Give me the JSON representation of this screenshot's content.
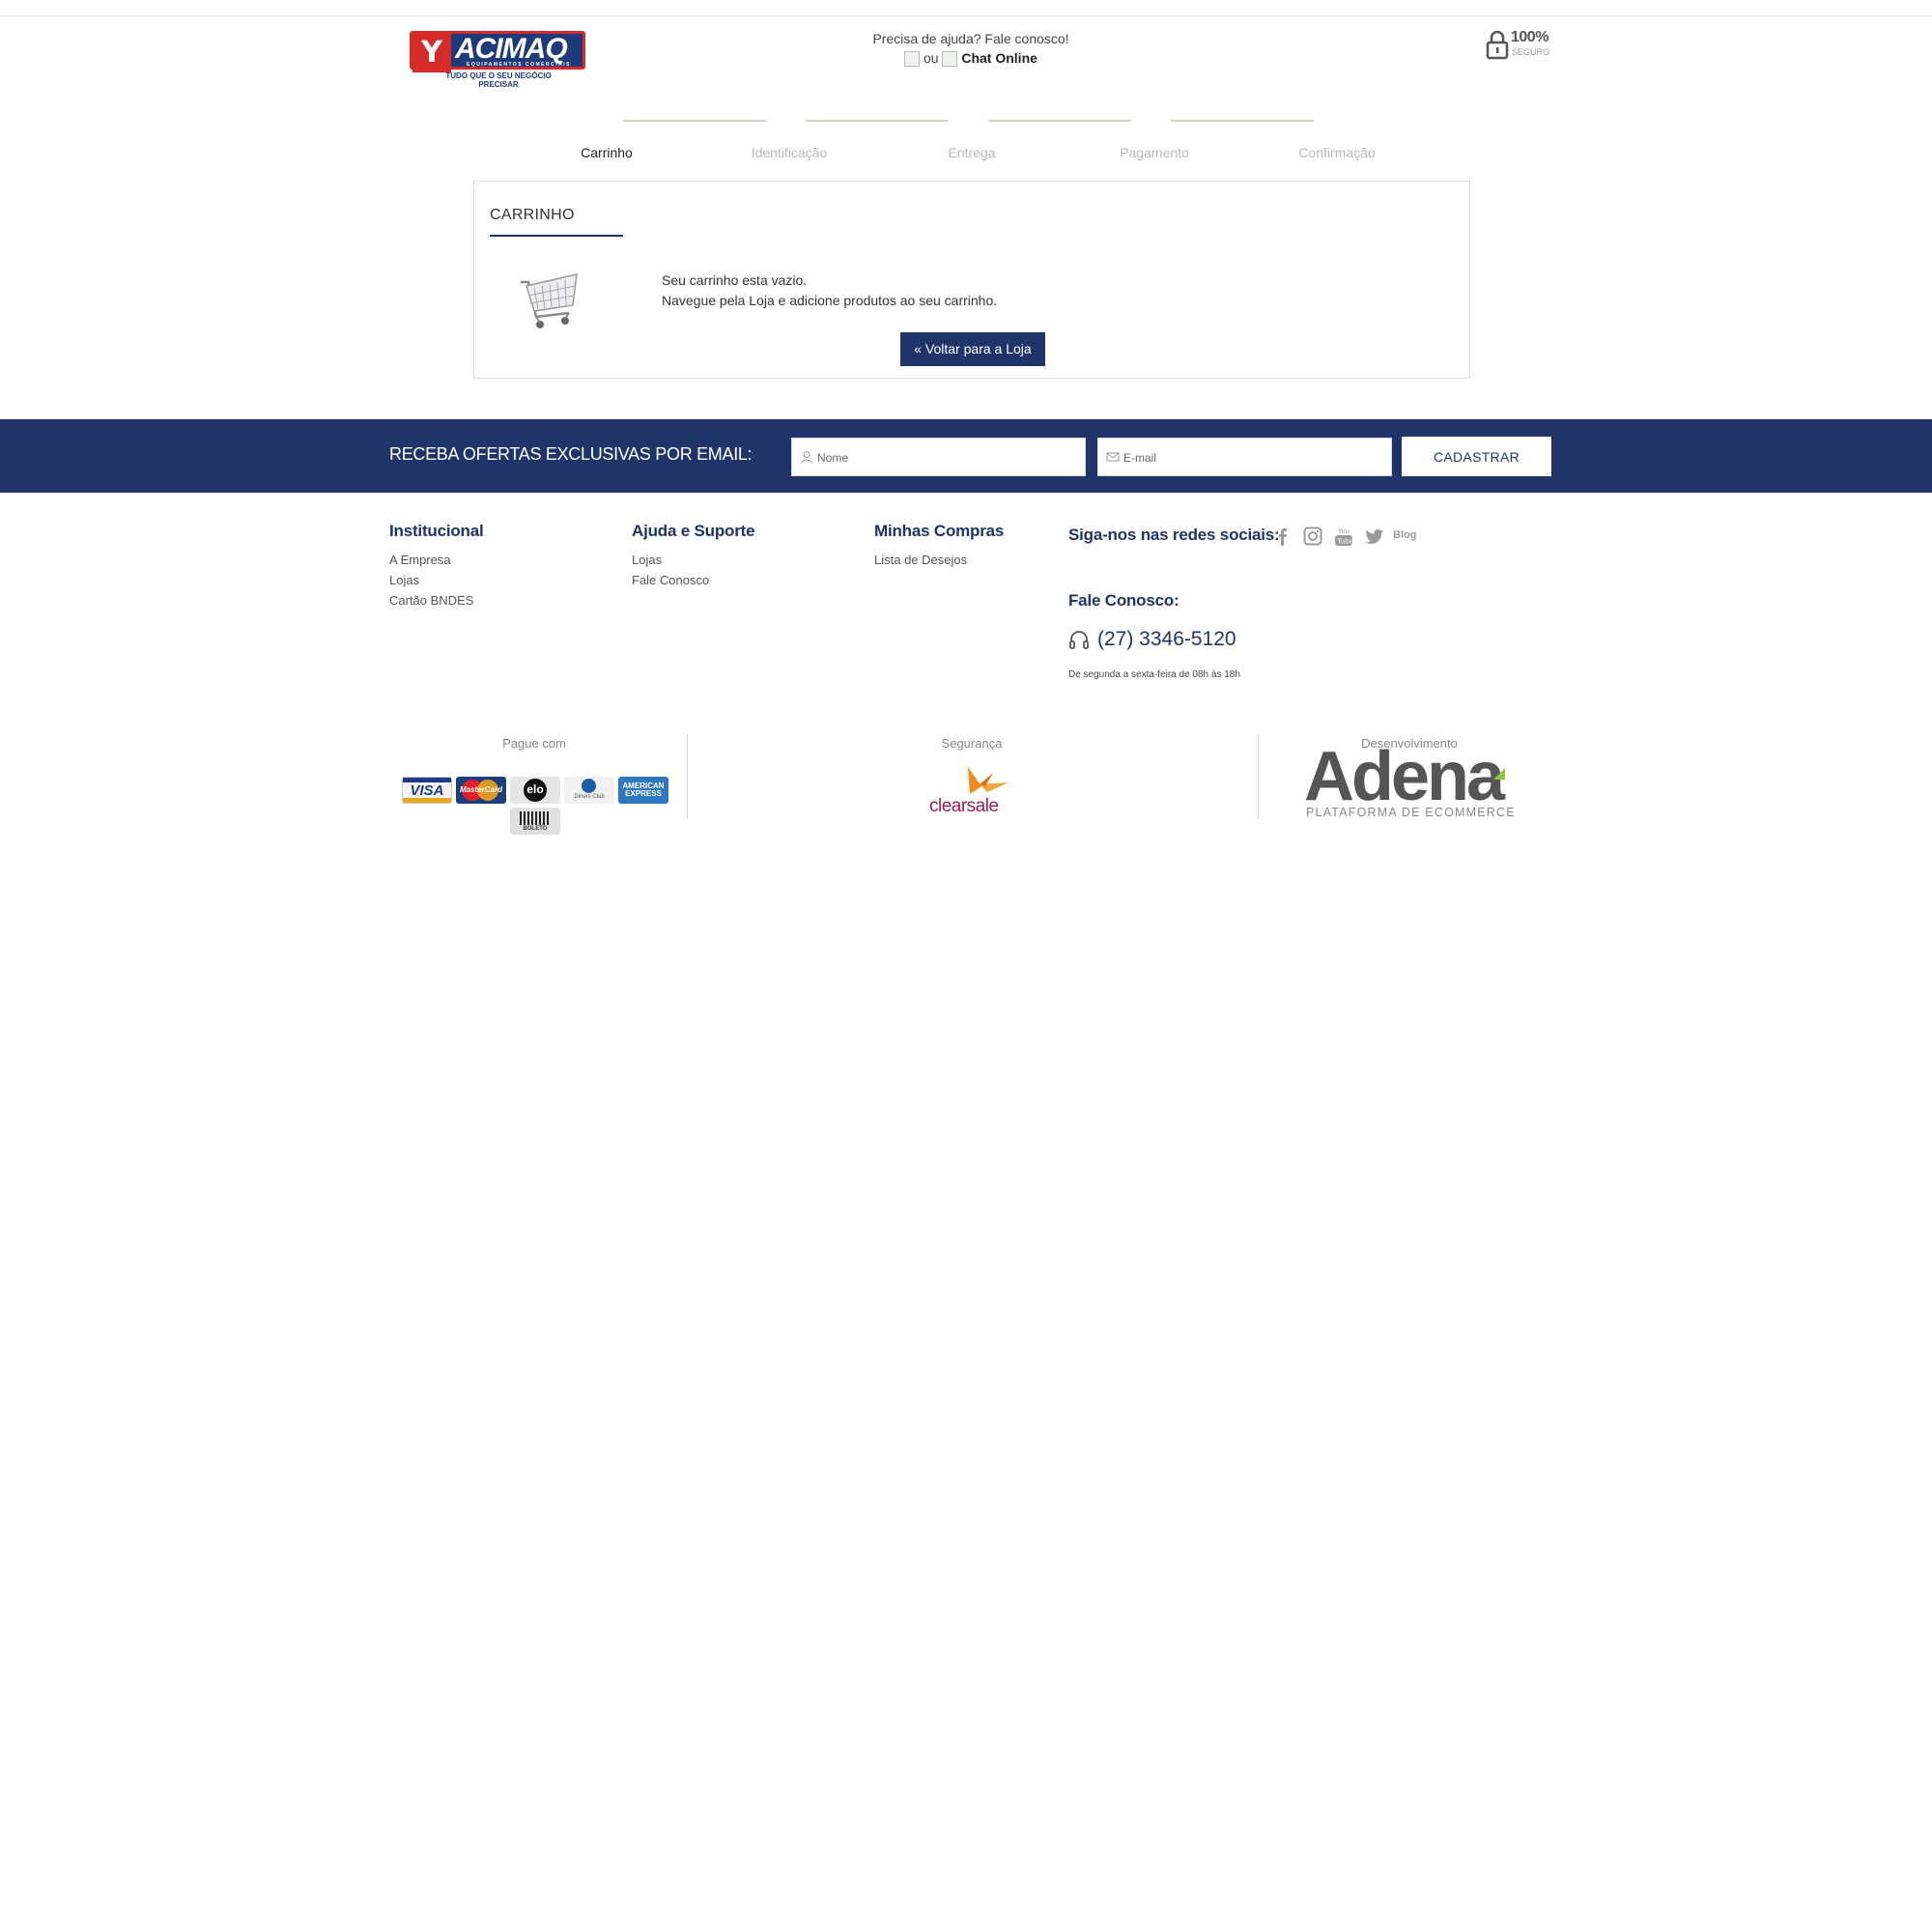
{
  "header": {
    "logo": {
      "brand": "ACIMAQ",
      "subtitle": "EQUIPAMENTOS COMERCIAIS",
      "tagline": "TUDO QUE O SEU NEGÓCIO PRECISAR"
    },
    "help_text": "Precisa de ajuda? Fale conosco!",
    "or_text": "ou",
    "chat_label": "Chat Online",
    "secure_pct": "100%",
    "secure_label": "SEGURO"
  },
  "steps": [
    {
      "label": "Carrinho",
      "active": true
    },
    {
      "label": "Identificação",
      "active": false
    },
    {
      "label": "Entrega",
      "active": false
    },
    {
      "label": "Pagamento",
      "active": false
    },
    {
      "label": "Confirmação",
      "active": false
    }
  ],
  "cart": {
    "title": "CARRINHO",
    "empty_msg": "Seu carrinho esta vazio.",
    "hint_msg": "Navegue pela Loja e adicione produtos ao seu carrinho.",
    "back_button": "« Voltar para a Loja"
  },
  "newsletter": {
    "label": "RECEBA OFERTAS EXCLUSIVAS POR EMAIL:",
    "name_placeholder": "Nome",
    "email_placeholder": "E-mail",
    "submit": "CADASTRAR"
  },
  "footer": {
    "columns": [
      {
        "title": "Institucional",
        "links": [
          "A Empresa",
          "Lojas",
          "Cartão BNDES"
        ]
      },
      {
        "title": "Ajuda e Suporte",
        "links": [
          "Lojas",
          "Fale Conosco"
        ]
      },
      {
        "title": "Minhas Compras",
        "links": [
          "Lista de Desejos"
        ]
      }
    ],
    "social_label": "Siga-nos nas redes sociais:",
    "social_icons": [
      "facebook-icon",
      "instagram-icon",
      "youtube-icon",
      "twitter-icon"
    ],
    "blog_label": "Blog",
    "contact_title": "Fale Conosco:",
    "phone": "(27) 3346-5120",
    "hours": "De segunda a sexta-feira de 08h às 18h"
  },
  "bottom": {
    "pay_label": "Pague com",
    "cards": [
      "VISA",
      "MasterCard",
      "elo",
      "Diners Club",
      "AMERICAN EXPRESS",
      "BOLETO"
    ],
    "security_label": "Segurança",
    "security_brand": "clearsale",
    "dev_label": "Desenvolvimento",
    "dev_brand": "Adena",
    "dev_sub": "PLATAFORMA DE ECOMMERCE"
  },
  "colors": {
    "navy": "#1f3468",
    "brand_red": "#d52b2b",
    "muted_step": "#b8b8b8",
    "clearsale": "#9a1f59"
  }
}
